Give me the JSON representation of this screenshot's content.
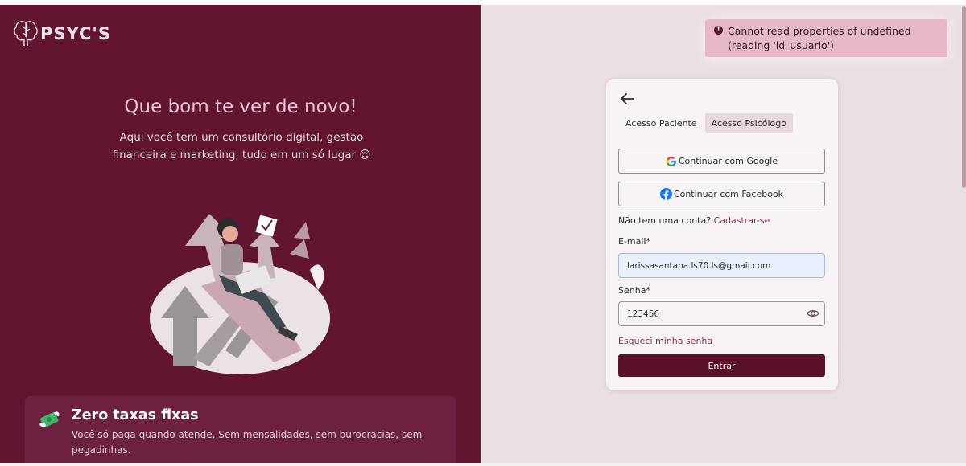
{
  "brand": {
    "name": "PSYC'S"
  },
  "hero": {
    "title": "Que bom te ver de novo!",
    "subtitle": "Aqui você tem um consultório digital, gestão financeira e marketing, tudo em um só lugar 😌"
  },
  "feature": {
    "title": "Zero taxas fixas",
    "description": "Você só paga quando atende. Sem mensalidades, sem burocracias, sem pegadinhas."
  },
  "toast": {
    "message": "Cannot read properties of undefined (reading 'id_usuario')"
  },
  "login": {
    "tabs": [
      {
        "label": "Acesso Paciente",
        "active": false
      },
      {
        "label": "Acesso Psicólogo",
        "active": true
      }
    ],
    "google_label": "Continuar com Google",
    "facebook_label": "Continuar com Facebook",
    "signup_prompt": "Não tem uma conta?",
    "signup_link": "Cadastrar-se",
    "email_label": "E-mail*",
    "email_value": "larissasantana.ls70.ls@gmail.com",
    "password_label": "Senha*",
    "password_value": "123456",
    "forgot_label": "Esqueci minha senha",
    "submit_label": "Entrar"
  },
  "colors": {
    "left_panel": "#611531",
    "right_panel": "#eadfe2",
    "accent": "#5a1027",
    "link": "#8a3355",
    "toast_bg": "#e6b8c8"
  }
}
